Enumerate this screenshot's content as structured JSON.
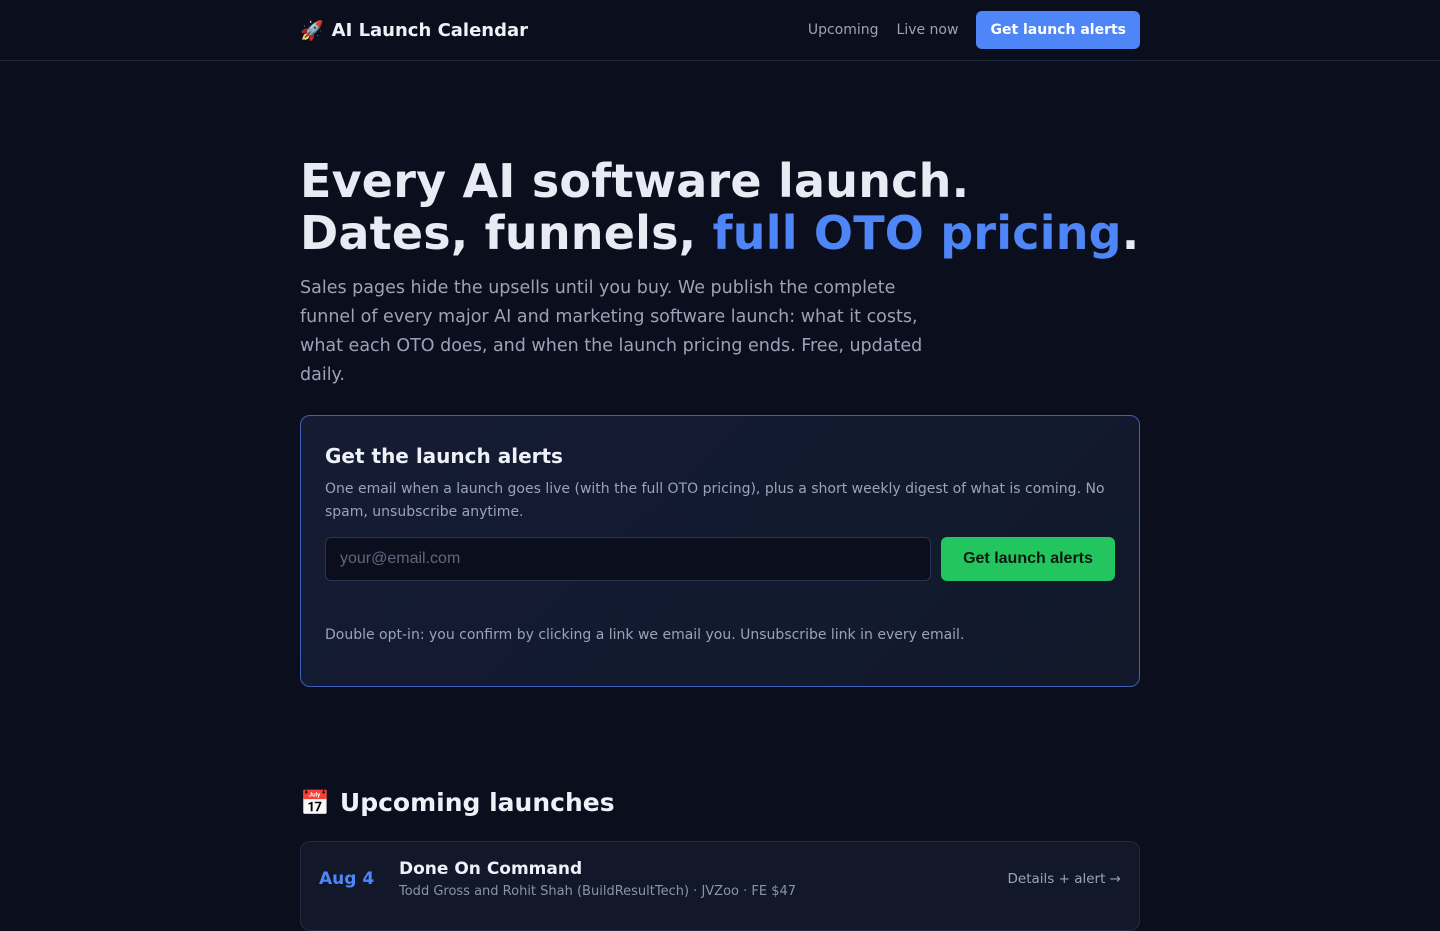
{
  "nav": {
    "brand_icon": "🚀",
    "brand_text": "AI Launch Calendar",
    "links": [
      "Upcoming",
      "Live now"
    ],
    "cta_label": "Get launch alerts"
  },
  "hero": {
    "title_line1": "Every AI software launch.",
    "title_line2_prefix": "Dates, funnels, ",
    "title_line2_accent": "full OTO pricing",
    "title_line2_suffix": ".",
    "subtitle": "Sales pages hide the upsells until you buy. We publish the complete funnel of every major AI and marketing software launch: what it costs, what each OTO does, and when the launch pricing ends. Free, updated daily."
  },
  "signup": {
    "title": "Get the launch alerts",
    "description": "One email when a launch goes live (with the full OTO pricing), plus a short weekly digest of what is coming. No spam, unsubscribe anytime.",
    "email_placeholder": "your@email.com",
    "button_label": "Get launch alerts",
    "note": "Double opt-in: you confirm by clicking a link we email you. Unsubscribe link in every email."
  },
  "upcoming": {
    "icon": "📅",
    "heading": "Upcoming launches",
    "items": [
      {
        "date": "Aug 4",
        "name": "Done On Command",
        "meta": "Todd Gross and Rohit Shah (BuildResultTech) · JVZoo · FE $47",
        "link": "Details + alert →"
      }
    ]
  },
  "colors": {
    "background": "#0b0f1d",
    "accent_blue": "#4f86f7",
    "accent_green": "#22c55e"
  }
}
